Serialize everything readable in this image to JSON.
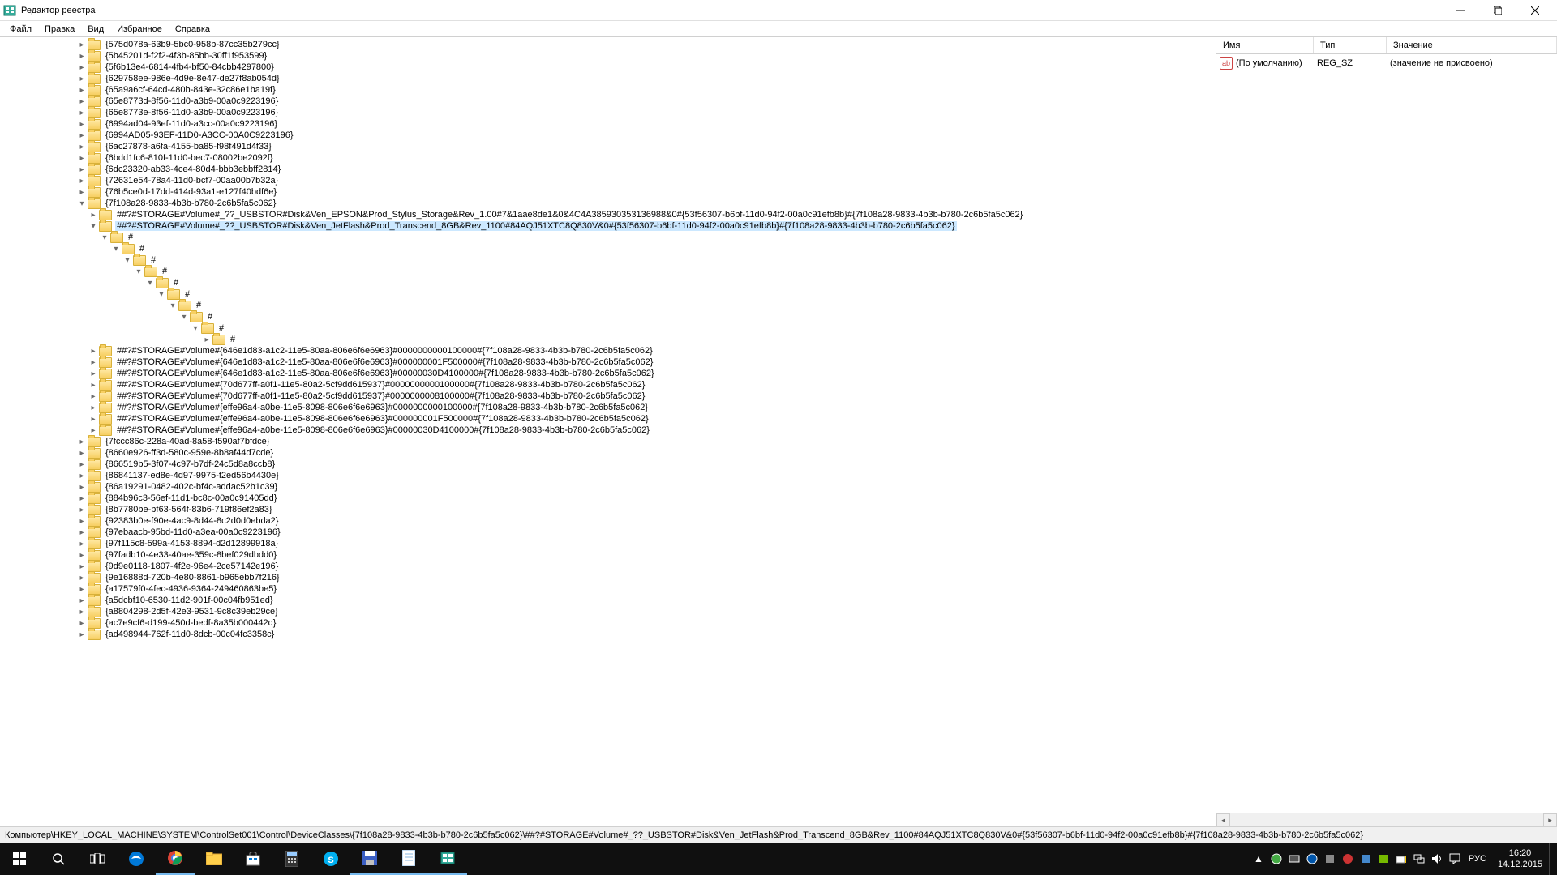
{
  "window": {
    "title": "Редактор реестра"
  },
  "menu": {
    "file": "Файл",
    "edit": "Правка",
    "view": "Вид",
    "favorites": "Избранное",
    "help": "Справка"
  },
  "tree": {
    "base_indent": 90,
    "items": [
      {
        "d": 0,
        "tw": "col",
        "t": "{575d078a-63b9-5bc0-958b-87cc35b279cc}"
      },
      {
        "d": 0,
        "tw": "col",
        "t": "{5b45201d-f2f2-4f3b-85bb-30ff1f953599}"
      },
      {
        "d": 0,
        "tw": "col",
        "t": "{5f6b13e4-6814-4fb4-bf50-84cbb4297800}"
      },
      {
        "d": 0,
        "tw": "col",
        "t": "{629758ee-986e-4d9e-8e47-de27f8ab054d}"
      },
      {
        "d": 0,
        "tw": "col",
        "t": "{65a9a6cf-64cd-480b-843e-32c86e1ba19f}"
      },
      {
        "d": 0,
        "tw": "col",
        "t": "{65e8773d-8f56-11d0-a3b9-00a0c9223196}"
      },
      {
        "d": 0,
        "tw": "col",
        "t": "{65e8773e-8f56-11d0-a3b9-00a0c9223196}"
      },
      {
        "d": 0,
        "tw": "col",
        "t": "{6994ad04-93ef-11d0-a3cc-00a0c9223196}"
      },
      {
        "d": 0,
        "tw": "col",
        "t": "{6994AD05-93EF-11D0-A3CC-00A0C9223196}"
      },
      {
        "d": 0,
        "tw": "col",
        "t": "{6ac27878-a6fa-4155-ba85-f98f491d4f33}"
      },
      {
        "d": 0,
        "tw": "col",
        "t": "{6bdd1fc6-810f-11d0-bec7-08002be2092f}"
      },
      {
        "d": 0,
        "tw": "col",
        "t": "{6dc23320-ab33-4ce4-80d4-bbb3ebbff2814}"
      },
      {
        "d": 0,
        "tw": "col",
        "t": "{72631e54-78a4-11d0-bcf7-00aa00b7b32a}"
      },
      {
        "d": 0,
        "tw": "col",
        "t": "{76b5ce0d-17dd-414d-93a1-e127f40bdf6e}"
      },
      {
        "d": 0,
        "tw": "exp",
        "t": "{7f108a28-9833-4b3b-b780-2c6b5fa5c062}"
      },
      {
        "d": 1,
        "tw": "col",
        "t": "##?#STORAGE#Volume#_??_USBSTOR#Disk&Ven_EPSON&Prod_Stylus_Storage&Rev_1.00#7&1aae8de1&0&4C4A385930353136988&0#{53f56307-b6bf-11d0-94f2-00a0c91efb8b}#{7f108a28-9833-4b3b-b780-2c6b5fa5c062}"
      },
      {
        "d": 1,
        "tw": "exp",
        "t": "##?#STORAGE#Volume#_??_USBSTOR#Disk&Ven_JetFlash&Prod_Transcend_8GB&Rev_1100#84AQJ51XTC8Q830V&0#{53f56307-b6bf-11d0-94f2-00a0c91efb8b}#{7f108a28-9833-4b3b-b780-2c6b5fa5c062}",
        "sel": true
      },
      {
        "d": 2,
        "tw": "exp",
        "t": "#"
      },
      {
        "d": 3,
        "tw": "exp",
        "t": "#"
      },
      {
        "d": 4,
        "tw": "exp",
        "t": "#"
      },
      {
        "d": 5,
        "tw": "exp",
        "t": "#"
      },
      {
        "d": 6,
        "tw": "exp",
        "t": "#"
      },
      {
        "d": 7,
        "tw": "exp",
        "t": "#"
      },
      {
        "d": 8,
        "tw": "exp",
        "t": "#"
      },
      {
        "d": 9,
        "tw": "exp",
        "t": "#"
      },
      {
        "d": 10,
        "tw": "exp",
        "t": "#"
      },
      {
        "d": 11,
        "tw": "col",
        "t": "#"
      },
      {
        "d": 1,
        "tw": "col",
        "t": "##?#STORAGE#Volume#{646e1d83-a1c2-11e5-80aa-806e6f6e6963}#0000000000100000#{7f108a28-9833-4b3b-b780-2c6b5fa5c062}"
      },
      {
        "d": 1,
        "tw": "col",
        "t": "##?#STORAGE#Volume#{646e1d83-a1c2-11e5-80aa-806e6f6e6963}#000000001F500000#{7f108a28-9833-4b3b-b780-2c6b5fa5c062}"
      },
      {
        "d": 1,
        "tw": "col",
        "t": "##?#STORAGE#Volume#{646e1d83-a1c2-11e5-80aa-806e6f6e6963}#00000030D4100000#{7f108a28-9833-4b3b-b780-2c6b5fa5c062}"
      },
      {
        "d": 1,
        "tw": "col",
        "t": "##?#STORAGE#Volume#{70d677ff-a0f1-11e5-80a2-5cf9dd615937}#0000000000100000#{7f108a28-9833-4b3b-b780-2c6b5fa5c062}"
      },
      {
        "d": 1,
        "tw": "col",
        "t": "##?#STORAGE#Volume#{70d677ff-a0f1-11e5-80a2-5cf9dd615937}#0000000008100000#{7f108a28-9833-4b3b-b780-2c6b5fa5c062}"
      },
      {
        "d": 1,
        "tw": "col",
        "t": "##?#STORAGE#Volume#{effe96a4-a0be-11e5-8098-806e6f6e6963}#0000000000100000#{7f108a28-9833-4b3b-b780-2c6b5fa5c062}"
      },
      {
        "d": 1,
        "tw": "col",
        "t": "##?#STORAGE#Volume#{effe96a4-a0be-11e5-8098-806e6f6e6963}#000000001F500000#{7f108a28-9833-4b3b-b780-2c6b5fa5c062}"
      },
      {
        "d": 1,
        "tw": "col",
        "t": "##?#STORAGE#Volume#{effe96a4-a0be-11e5-8098-806e6f6e6963}#00000030D4100000#{7f108a28-9833-4b3b-b780-2c6b5fa5c062}"
      },
      {
        "d": 0,
        "tw": "col",
        "t": "{7fccc86c-228a-40ad-8a58-f590af7bfdce}"
      },
      {
        "d": 0,
        "tw": "col",
        "t": "{8660e926-ff3d-580c-959e-8b8af44d7cde}"
      },
      {
        "d": 0,
        "tw": "col",
        "t": "{866519b5-3f07-4c97-b7df-24c5d8a8ccb8}"
      },
      {
        "d": 0,
        "tw": "col",
        "t": "{86841137-ed8e-4d97-9975-f2ed56b4430e}"
      },
      {
        "d": 0,
        "tw": "col",
        "t": "{86a19291-0482-402c-bf4c-addac52b1c39}"
      },
      {
        "d": 0,
        "tw": "col",
        "t": "{884b96c3-56ef-11d1-bc8c-00a0c91405dd}"
      },
      {
        "d": 0,
        "tw": "col",
        "t": "{8b7780be-bf63-564f-83b6-719f86ef2a83}"
      },
      {
        "d": 0,
        "tw": "col",
        "t": "{92383b0e-f90e-4ac9-8d44-8c2d0d0ebda2}"
      },
      {
        "d": 0,
        "tw": "col",
        "t": "{97ebaacb-95bd-11d0-a3ea-00a0c9223196}"
      },
      {
        "d": 0,
        "tw": "col",
        "t": "{97f115c8-599a-4153-8894-d2d12899918a}"
      },
      {
        "d": 0,
        "tw": "col",
        "t": "{97fadb10-4e33-40ae-359c-8bef029dbdd0}"
      },
      {
        "d": 0,
        "tw": "col",
        "t": "{9d9e0118-1807-4f2e-96e4-2ce57142e196}"
      },
      {
        "d": 0,
        "tw": "col",
        "t": "{9e16888d-720b-4e80-8861-b965ebb7f216}"
      },
      {
        "d": 0,
        "tw": "col",
        "t": "{a17579f0-4fec-4936-9364-249460863be5}"
      },
      {
        "d": 0,
        "tw": "col",
        "t": "{a5dcbf10-6530-11d2-901f-00c04fb951ed}"
      },
      {
        "d": 0,
        "tw": "col",
        "t": "{a8804298-2d5f-42e3-9531-9c8c39eb29ce}"
      },
      {
        "d": 0,
        "tw": "col",
        "t": "{ac7e9cf6-d199-450d-bedf-8a35b000442d}"
      },
      {
        "d": 0,
        "tw": "col",
        "t": "{ad498944-762f-11d0-8dcb-00c04fc3358c}"
      }
    ]
  },
  "list": {
    "cols": {
      "name": "Имя",
      "type": "Тип",
      "value": "Значение"
    },
    "rows": [
      {
        "name": "(По умолчанию)",
        "type": "REG_SZ",
        "value": "(значение не присвоено)"
      }
    ]
  },
  "status": {
    "path": "Компьютер\\HKEY_LOCAL_MACHINE\\SYSTEM\\ControlSet001\\Control\\DeviceClasses\\{7f108a28-9833-4b3b-b780-2c6b5fa5c062}\\##?#STORAGE#Volume#_??_USBSTOR#Disk&Ven_JetFlash&Prod_Transcend_8GB&Rev_1100#84AQJ51XTC8Q830V&0#{53f56307-b6bf-11d0-94f2-00a0c91efb8b}#{7f108a28-9833-4b3b-b780-2c6b5fa5c062}"
  },
  "taskbar": {
    "lang": "РУС",
    "time": "16:20",
    "date": "14.12.2015"
  }
}
